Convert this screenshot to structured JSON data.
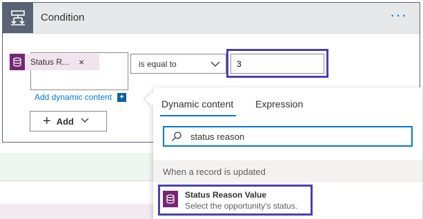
{
  "card": {
    "title": "Condition",
    "more_label": "···"
  },
  "condition": {
    "left_token": {
      "label": "Status R...",
      "remove": "×",
      "icon": "database-icon"
    },
    "add_dynamic_label": "Add dynamic content",
    "add_dynamic_plus": "+",
    "operator": "is equal to",
    "value": "3"
  },
  "add_button": {
    "plus": "+",
    "label": "Add"
  },
  "popup": {
    "tabs": [
      {
        "label": "Dynamic content",
        "active": true
      },
      {
        "label": "Expression",
        "active": false
      }
    ],
    "search_value": "status reason",
    "section_label": "When a record is updated",
    "results": [
      {
        "title": "Status Reason Value",
        "description": "Select the opportunity's status.",
        "icon": "database-icon"
      }
    ]
  },
  "colors": {
    "accent": "#0078d4",
    "highlight": "#4b3fb0",
    "token_icon": "#742774",
    "header_icon_bg": "#5a6373"
  }
}
